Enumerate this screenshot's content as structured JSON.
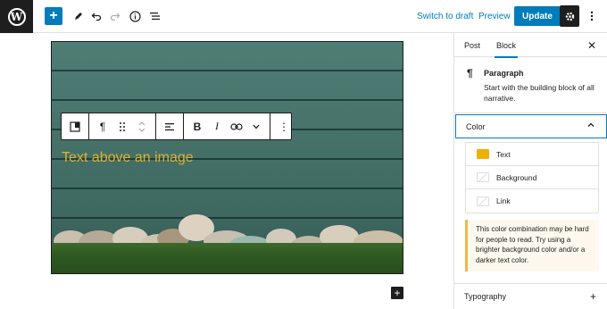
{
  "toolbar": {
    "logo_glyph": "W",
    "add_glyph": "+",
    "switch_to_draft": "Switch to draft",
    "preview": "Preview",
    "update": "Update",
    "icons": [
      "pencil-icon",
      "undo-icon",
      "redo-icon",
      "info-icon",
      "list-view-icon",
      "gear-icon",
      "more-vertical-icon"
    ]
  },
  "editor": {
    "image_text": "Text above an image",
    "text_color": "#e0b030",
    "block_toolbar": {
      "paragraph_glyph": "¶",
      "bold_glyph": "B",
      "italic_glyph": "I",
      "more_glyph": "⋮"
    },
    "inserter_glyph": "+"
  },
  "sidebar": {
    "tabs": [
      {
        "label": "Post"
      },
      {
        "label": "Block"
      }
    ],
    "active_tab": "Block",
    "close_glyph": "✕",
    "block": {
      "icon_glyph": "¶",
      "title": "Paragraph",
      "description": "Start with the building block of all narrative."
    },
    "color_panel": {
      "title": "Color",
      "items": [
        {
          "label": "Text",
          "swatch": "#f0b000"
        },
        {
          "label": "Background",
          "swatch": ""
        },
        {
          "label": "Link",
          "swatch": ""
        }
      ]
    },
    "notice": "This color combination may be hard for people to read. Try using a brighter background color and/or a darker text color.",
    "typography": {
      "title": "Typography",
      "plus_glyph": "+"
    }
  },
  "colors": {
    "accent": "#007cba",
    "dark": "#1e1e1e",
    "warning": "#f0b849"
  }
}
